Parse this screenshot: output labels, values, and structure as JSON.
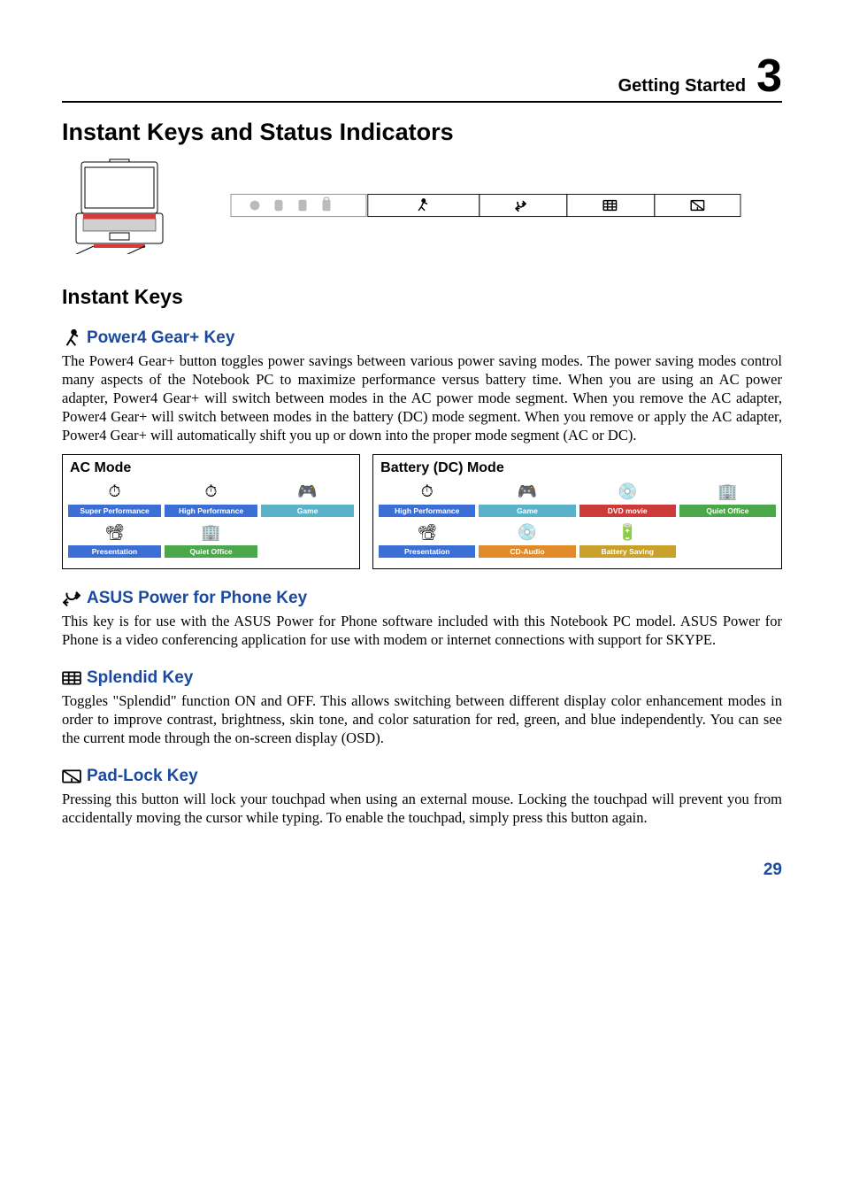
{
  "header": {
    "section": "Getting Started",
    "chapter": "3"
  },
  "title": "Instant Keys and Status Indicators",
  "instant_keys_heading": "Instant Keys",
  "keys": {
    "power4": {
      "title": "Power4 Gear+ Key",
      "body": "The Power4 Gear+ button toggles power savings between various power saving modes. The power saving modes control many aspects of the Notebook PC to maximize performance versus battery time. When you are using an AC power adapter, Power4 Gear+ will switch between modes in the AC power mode segment. When you remove the AC adapter, Power4 Gear+ will switch between modes in the battery (DC) mode segment. When you remove or apply the AC adapter, Power4 Gear+ will automatically shift you up or down into the proper mode segment (AC or DC)."
    },
    "asus_phone": {
      "title": "ASUS Power for Phone Key",
      "body": "This key is for use with the ASUS Power for Phone software included with this Notebook PC model. ASUS Power for Phone is a video conferencing application for use with modem or internet connections with support for SKYPE."
    },
    "splendid": {
      "title": "Splendid Key",
      "body": "Toggles \"Splendid\" function ON and OFF. This allows switching between different display color enhancement modes in order to improve contrast, brightness, skin tone, and color saturation for red, green, and blue independently. You can see the current mode through the on-screen display (OSD)."
    },
    "padlock": {
      "title": "Pad-Lock Key",
      "body": "Pressing this button will lock your touchpad when using an external mouse. Locking the touchpad will prevent you from accidentally moving the cursor while typing. To enable the touchpad, simply press this button again."
    }
  },
  "modes": {
    "ac": {
      "title": "AC Mode",
      "row1": [
        {
          "label": "Super Performance",
          "cls": "lbl-blue",
          "glyph": "⏱"
        },
        {
          "label": "High Performance",
          "cls": "lbl-blue",
          "glyph": "⏱"
        },
        {
          "label": "Game",
          "cls": "lbl-cyan",
          "glyph": "🎮"
        }
      ],
      "row2": [
        {
          "label": "Presentation",
          "cls": "lbl-blue",
          "glyph": "📽"
        },
        {
          "label": "Quiet Office",
          "cls": "lbl-green",
          "glyph": "🏢"
        }
      ]
    },
    "dc": {
      "title": "Battery (DC) Mode",
      "row1": [
        {
          "label": "High Performance",
          "cls": "lbl-blue",
          "glyph": "⏱"
        },
        {
          "label": "Game",
          "cls": "lbl-cyan",
          "glyph": "🎮"
        },
        {
          "label": "DVD movie",
          "cls": "lbl-red",
          "glyph": "💿"
        },
        {
          "label": "Quiet Office",
          "cls": "lbl-green",
          "glyph": "🏢"
        }
      ],
      "row2": [
        {
          "label": "Presentation",
          "cls": "lbl-blue",
          "glyph": "📽"
        },
        {
          "label": "CD-Audio",
          "cls": "lbl-orange",
          "glyph": "💿"
        },
        {
          "label": "Battery Saving",
          "cls": "lbl-gold",
          "glyph": "🔋"
        }
      ]
    }
  },
  "icons": {
    "power4": "runner-icon",
    "phone": "phone-swap-icon",
    "splendid": "splendid-icon",
    "padlock": "touchpad-lock-icon"
  },
  "page_number": "29"
}
